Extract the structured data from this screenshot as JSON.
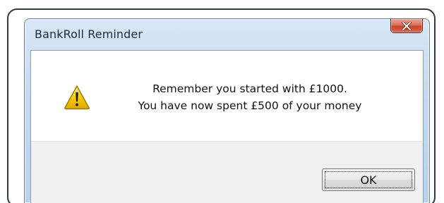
{
  "window": {
    "title": "BankRoll Reminder"
  },
  "titlebar": {
    "close_icon": "close-x-icon"
  },
  "message": {
    "icon": "warning-triangle-icon",
    "line1": "Remember you started with £1000.",
    "line2": "You have now spent £500 of your money"
  },
  "buttons": {
    "ok_label": "OK"
  },
  "colors": {
    "close_button": "#c7422b",
    "warning_yellow": "#f5c400"
  }
}
